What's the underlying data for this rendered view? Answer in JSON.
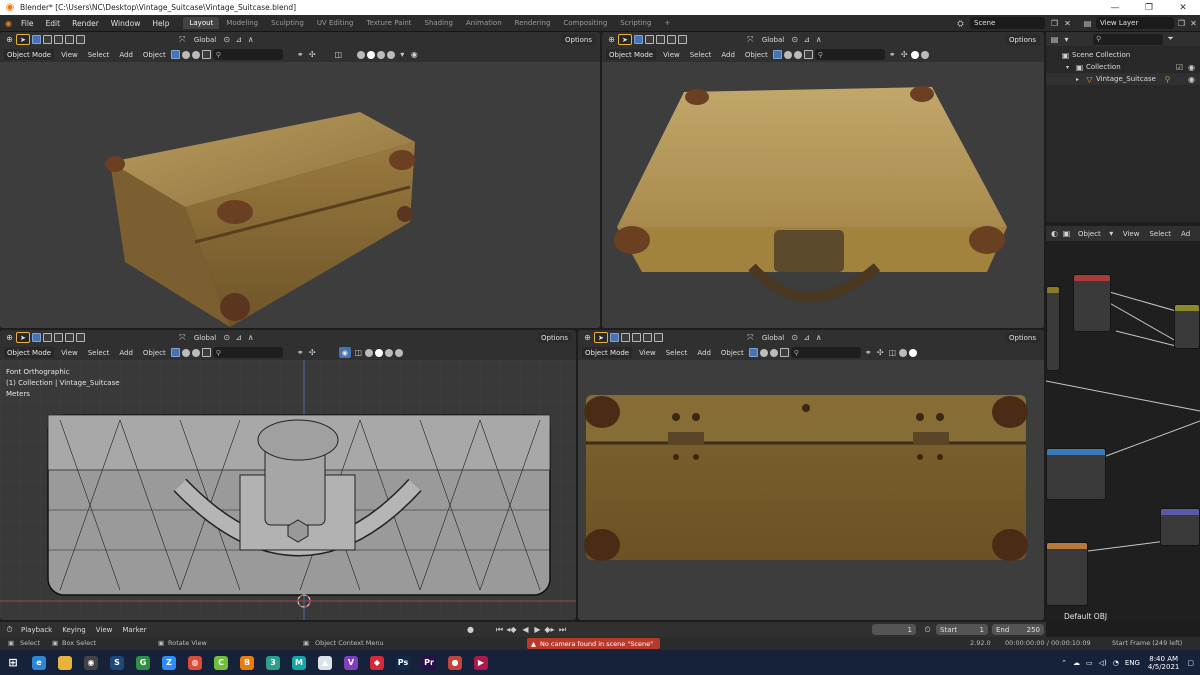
{
  "window": {
    "title": "Blender* [C:\\Users\\NC\\Desktop\\Vintage_Suitcase\\Vintage_Suitcase.blend]",
    "controls": [
      "—",
      "❐",
      "✕"
    ]
  },
  "menu": [
    "File",
    "Edit",
    "Render",
    "Window",
    "Help"
  ],
  "workspaces": [
    "Layout",
    "Modeling",
    "Sculpting",
    "UV Editing",
    "Texture Paint",
    "Shading",
    "Animation",
    "Rendering",
    "Compositing",
    "Scripting"
  ],
  "active_workspace": "Layout",
  "add_workspace": "+",
  "scene": {
    "value": "Scene"
  },
  "view_layer": {
    "value": "View Layer"
  },
  "viewport_header": {
    "transform_orientation": "Global",
    "options": "Options",
    "mode": "Object Mode",
    "view": "View",
    "select": "Select",
    "add": "Add",
    "object": "Object"
  },
  "viewport_bl": {
    "view_name": "Font Orthographic",
    "collection_info": "(1) Collection | Vintage_Suitcase",
    "units": "Meters"
  },
  "outliner": {
    "root": "Scene Collection",
    "collection": "Collection",
    "object": "Vintage_Suitcase"
  },
  "node_editor": {
    "mode": "Object",
    "view": "View",
    "select": "Select",
    "add": "Ad",
    "material_name": "Default OBJ"
  },
  "timeline": {
    "playback": "Playback",
    "keying": "Keying",
    "view": "View",
    "marker": "Marker",
    "current_frame": "1",
    "start_label": "Start",
    "start_value": "1",
    "end_label": "End",
    "end_value": "250"
  },
  "statusbar": {
    "select": "Select",
    "box_select": "Box Select",
    "rotate_view": "Rotate View",
    "context_menu": "Object Context Menu",
    "warning": "No camera found in scene \"Scene\"",
    "version": "2.92.0",
    "time": "00:00:00:00 / 00:00:10:09",
    "start_frame": "Start Frame (249 left)"
  },
  "taskbar": {
    "apps": [
      {
        "name": "edge-icon",
        "color": "#2b88d8",
        "glyph": "e"
      },
      {
        "name": "file-explorer-icon",
        "color": "#e8b33a",
        "glyph": ""
      },
      {
        "name": "obs-icon",
        "color": "#444444",
        "glyph": "◉"
      },
      {
        "name": "steam-icon",
        "color": "#1b4a7a",
        "glyph": "S"
      },
      {
        "name": "gamepass-icon",
        "color": "#2f8f45",
        "glyph": "G"
      },
      {
        "name": "zoom-icon",
        "color": "#2d8cff",
        "glyph": "Z"
      },
      {
        "name": "chrome-icon",
        "color": "#de4a39",
        "glyph": "◍"
      },
      {
        "name": "app-green-icon",
        "color": "#6fbf3a",
        "glyph": "C"
      },
      {
        "name": "blender-icon",
        "color": "#e87d0d",
        "glyph": "B"
      },
      {
        "name": "app-3-icon",
        "color": "#2aa08a",
        "glyph": "3"
      },
      {
        "name": "maya-icon",
        "color": "#17a6a6",
        "glyph": "M"
      },
      {
        "name": "substance-icon",
        "color": "#d9e3e8",
        "glyph": "▲"
      },
      {
        "name": "visual-studio-icon",
        "color": "#7f3fbf",
        "glyph": "V"
      },
      {
        "name": "shield-icon",
        "color": "#d62a3a",
        "glyph": "◆"
      },
      {
        "name": "photoshop-icon",
        "color": "#0f2a4a",
        "glyph": "Ps"
      },
      {
        "name": "premiere-icon",
        "color": "#2a0f4a",
        "glyph": "Pr"
      },
      {
        "name": "davinci-icon",
        "color": "#c2453c",
        "glyph": "●"
      },
      {
        "name": "media-icon",
        "color": "#b0184a",
        "glyph": "▶"
      }
    ],
    "language": "ENG",
    "clock_time": "8:40 AM",
    "clock_date": "4/5/2021"
  }
}
